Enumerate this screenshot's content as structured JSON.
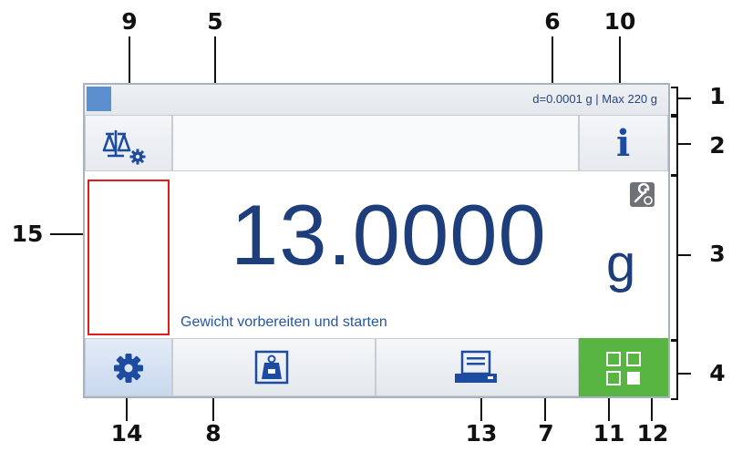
{
  "callouts": {
    "n1": "1",
    "n2": "2",
    "n3": "3",
    "n4": "4",
    "n5": "5",
    "n6": "6",
    "n7": "7",
    "n8": "8",
    "n9": "9",
    "n10": "10",
    "n11": "11",
    "n12": "12",
    "n13": "13",
    "n14": "14",
    "n15": "15"
  },
  "status_bar": {
    "info": "d=0.0001 g | Max 220 g"
  },
  "weight": {
    "value": "13.0000",
    "unit": "g"
  },
  "prompt": "Gewicht vorbereiten und starten",
  "icons": {
    "balance": "balance-settings-icon",
    "info": "info-icon",
    "wrench": "wrench-service-icon",
    "settings": "gear-icon",
    "tare": "weight-tare-icon",
    "print": "printer-icon",
    "apps": "apps-grid-icon"
  },
  "colors": {
    "accent_blue": "#1c4ba0",
    "apps_green": "#58b541",
    "highlight_red": "#e21b1b"
  },
  "info_glyph": "i"
}
